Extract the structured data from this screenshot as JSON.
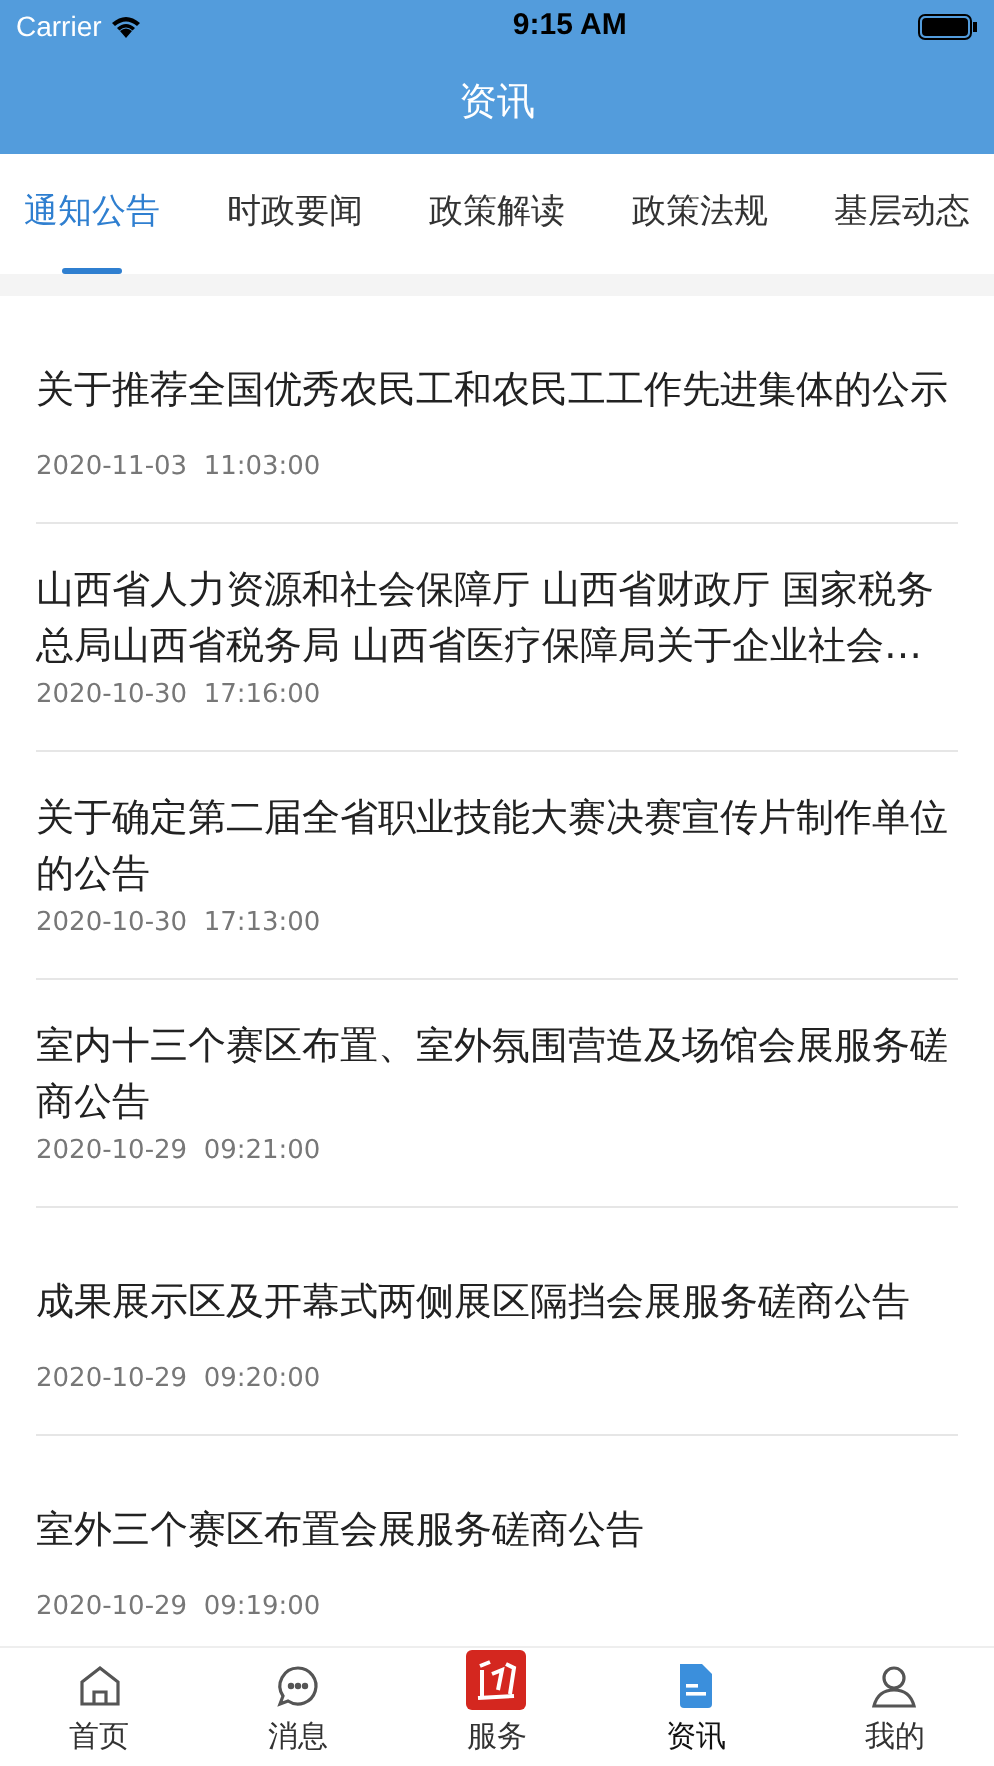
{
  "status_bar": {
    "carrier": "Carrier",
    "time": "9:15 AM"
  },
  "header": {
    "title": "资讯"
  },
  "tabs": [
    {
      "label": "通知公告",
      "selected": true
    },
    {
      "label": "时政要闻",
      "selected": false
    },
    {
      "label": "政策解读",
      "selected": false
    },
    {
      "label": "政策法规",
      "selected": false
    },
    {
      "label": "基层动态",
      "selected": false
    }
  ],
  "articles": [
    {
      "title": "关于推荐全国优秀农民工和农民工工作先进集体的公示",
      "date": "2020-11-03  11:03:00"
    },
    {
      "title": "山西省人力资源和社会保障厅 山西省财政厅 国家税务总局山西省税务局 山西省医疗保障局关于企业社会…",
      "date": "2020-10-30  17:16:00"
    },
    {
      "title": "关于确定第二届全省职业技能大赛决赛宣传片制作单位的公告",
      "date": "2020-10-30  17:13:00"
    },
    {
      "title": "室内十三个赛区布置、室外氛围营造及场馆会展服务磋商公告",
      "date": "2020-10-29  09:21:00"
    },
    {
      "title": "成果展示区及开幕式两侧展区隔挡会展服务磋商公告",
      "date": "2020-10-29  09:20:00"
    },
    {
      "title": "室外三个赛区布置会展服务磋商公告",
      "date": "2020-10-29  09:19:00"
    }
  ],
  "bottom_nav": [
    {
      "kind": "home",
      "label": "首页",
      "selected": false
    },
    {
      "kind": "message",
      "label": "消息",
      "selected": false
    },
    {
      "kind": "logo",
      "label": "服务",
      "selected": false
    },
    {
      "kind": "document",
      "label": "资讯",
      "selected": true
    },
    {
      "kind": "user",
      "label": "我的",
      "selected": false
    }
  ]
}
